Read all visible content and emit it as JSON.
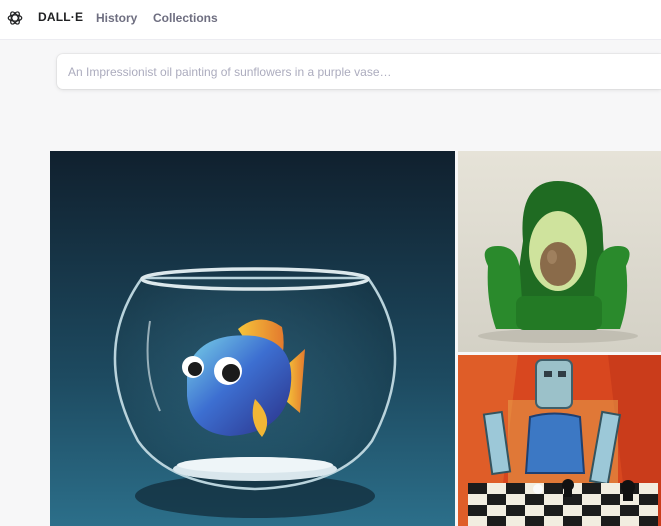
{
  "header": {
    "logo_icon": "openai-logo-icon",
    "brand": "DALL·E",
    "nav": [
      {
        "label": "History"
      },
      {
        "label": "Collections"
      }
    ]
  },
  "search": {
    "placeholder": "An Impressionist oil painting of sunflowers in a purple vase…",
    "value": ""
  },
  "gallery": [
    {
      "icon": "fishbowl-image"
    },
    {
      "icon": "avocado-armchair-image"
    },
    {
      "icon": "robot-chess-painting-image"
    }
  ],
  "colors": {
    "background": "#f7f7f8",
    "header_bg": "#ffffff",
    "brand_text": "#202123",
    "nav_text": "#6e6e80"
  }
}
